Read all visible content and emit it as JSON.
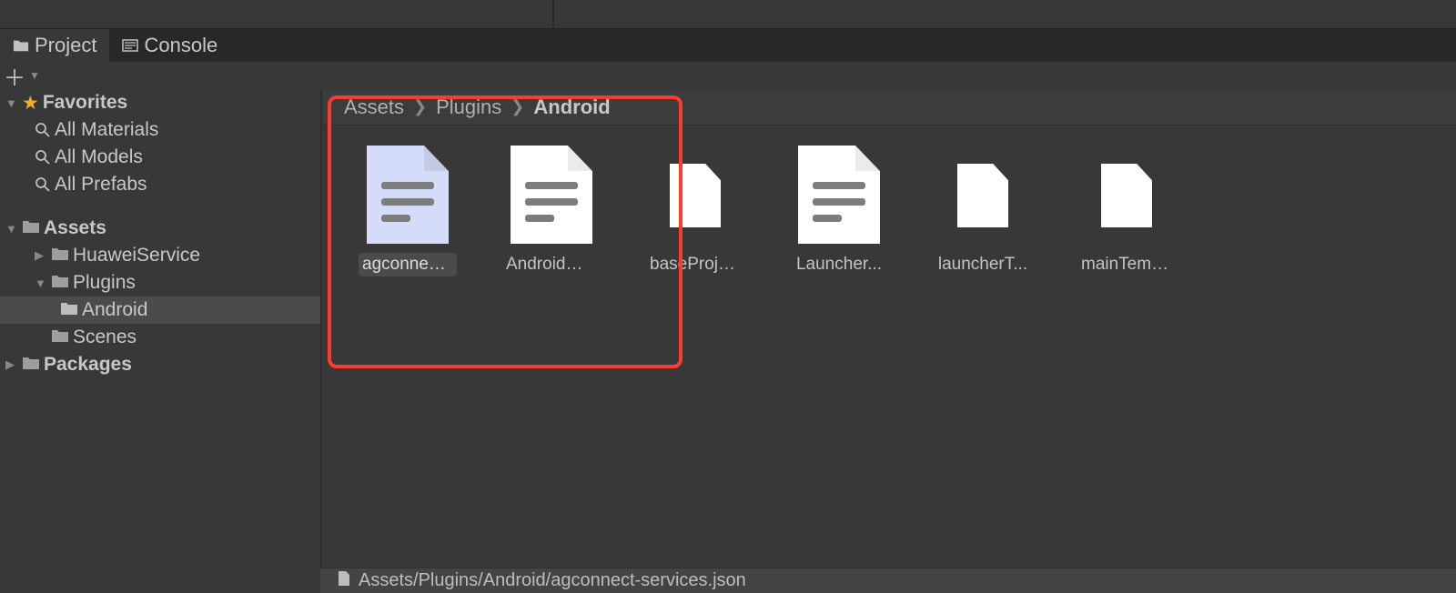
{
  "tabs": {
    "project": "Project",
    "console": "Console"
  },
  "sidebar": {
    "favorites": {
      "label": "Favorites",
      "items": [
        "All Materials",
        "All Models",
        "All Prefabs"
      ]
    },
    "assets": {
      "label": "Assets",
      "children": [
        {
          "label": "HuaweiService"
        },
        {
          "label": "Plugins",
          "children": [
            {
              "label": "Android",
              "selected": true
            }
          ]
        },
        {
          "label": "Scenes"
        }
      ]
    },
    "packages": {
      "label": "Packages"
    }
  },
  "breadcrumb": [
    "Assets",
    "Plugins",
    "Android"
  ],
  "files": [
    {
      "name": "agconnect...",
      "kind": "doc",
      "selected": true,
      "tint": "blue"
    },
    {
      "name": "AndroidMa...",
      "kind": "doc"
    },
    {
      "name": "baseProjec...",
      "kind": "plain"
    },
    {
      "name": "Launcher...",
      "kind": "doc"
    },
    {
      "name": "launcherT...",
      "kind": "plain"
    },
    {
      "name": "mainTempl...",
      "kind": "plain"
    }
  ],
  "status_path": "Assets/Plugins/Android/agconnect-services.json"
}
